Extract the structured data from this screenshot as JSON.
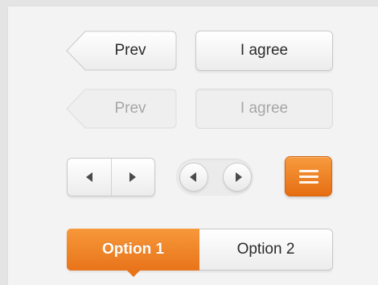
{
  "row1": {
    "prev_label": "Prev",
    "agree_label": "I agree"
  },
  "row2": {
    "prev_label": "Prev",
    "agree_label": "I agree",
    "state": "disabled"
  },
  "controls": {
    "segmented_prev_icon": "triangle-left-icon",
    "segmented_next_icon": "triangle-right-icon",
    "round_prev_icon": "triangle-left-icon",
    "round_next_icon": "triangle-right-icon",
    "menu_icon": "hamburger-menu-icon",
    "accent_color": "#f08326"
  },
  "tabs": [
    {
      "label": "Option 1",
      "active": true
    },
    {
      "label": "Option 2",
      "active": false
    }
  ]
}
